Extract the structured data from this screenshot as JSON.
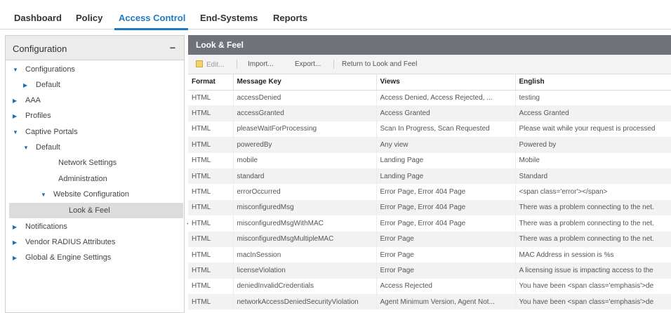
{
  "topnav": {
    "tabs": [
      {
        "label": "Dashboard"
      },
      {
        "label": "Policy"
      },
      {
        "label": "Access Control"
      },
      {
        "label": "End-Systems"
      },
      {
        "label": "Reports"
      }
    ],
    "active_tab": "Access Control"
  },
  "leftpanel": {
    "title": "Configuration",
    "collapse_icon": "−",
    "tree": [
      {
        "label": "Configurations",
        "arrow": "down"
      },
      {
        "label": "Default",
        "arrow": "right"
      },
      {
        "label": "AAA",
        "arrow": "right"
      },
      {
        "label": "Profiles",
        "arrow": "right"
      },
      {
        "label": "Captive Portals",
        "arrow": "down"
      },
      {
        "label": "Default",
        "arrow": "down"
      },
      {
        "label": "Network Settings",
        "arrow": "none"
      },
      {
        "label": "Administration",
        "arrow": "none"
      },
      {
        "label": "Website Configuration",
        "arrow": "down"
      },
      {
        "label": "Look & Feel",
        "arrow": "none",
        "selected": true
      },
      {
        "label": "Notifications",
        "arrow": "right"
      },
      {
        "label": "Vendor RADIUS Attributes",
        "arrow": "right"
      },
      {
        "label": "Global & Engine Settings",
        "arrow": "right"
      }
    ]
  },
  "rightpanel": {
    "title": "Look & Feel",
    "toolbar": {
      "edit": "Edit...",
      "import": "Import...",
      "export": "Export...",
      "return": "Return to Look and Feel"
    },
    "table": {
      "headers": [
        "Format",
        "Message Key",
        "Views",
        "English"
      ],
      "rows": [
        [
          "HTML",
          "accessDenied",
          "Access Denied, Access Rejected, ...",
          "testing"
        ],
        [
          "HTML",
          "accessGranted",
          "Access Granted",
          "Access Granted"
        ],
        [
          "HTML",
          "pleaseWaitForProcessing",
          "Scan In Progress, Scan Requested",
          "Please wait while your request is processed"
        ],
        [
          "HTML",
          "poweredBy",
          "Any view",
          "Powered by"
        ],
        [
          "HTML",
          "mobile",
          "Landing Page",
          "Mobile"
        ],
        [
          "HTML",
          "standard",
          "Landing Page",
          "Standard"
        ],
        [
          "HTML",
          "errorOccurred",
          "Error Page, Error 404 Page",
          "<span class='error'></span>"
        ],
        [
          "HTML",
          "misconfiguredMsg",
          "Error Page, Error 404 Page",
          "There was a problem connecting to the net."
        ],
        [
          "HTML",
          "misconfiguredMsgWithMAC",
          "Error Page, Error 404 Page",
          "There was a problem connecting to the net."
        ],
        [
          "HTML",
          "misconfiguredMsgMultipleMAC",
          "Error Page",
          "There was a problem connecting to the net."
        ],
        [
          "HTML",
          "macInSession",
          "Error Page",
          "MAC Address in session is %s"
        ],
        [
          "HTML",
          "licenseViolation",
          "Error Page",
          "A licensing issue is impacting access to the"
        ],
        [
          "HTML",
          "deniedInvalidCredentials",
          "Access Rejected",
          "You have been <span class='emphasis'>de"
        ],
        [
          "HTML",
          "networkAccessDeniedSecurityViolation",
          "Agent Minimum Version, Agent Not...",
          "You have been <span class='emphasis'>de"
        ]
      ]
    }
  },
  "colors": {
    "accent": "#1f7ac4",
    "panel_header": "#6f7279",
    "row_alt": "#f2f2f2",
    "selected": "#dcdcdc"
  }
}
